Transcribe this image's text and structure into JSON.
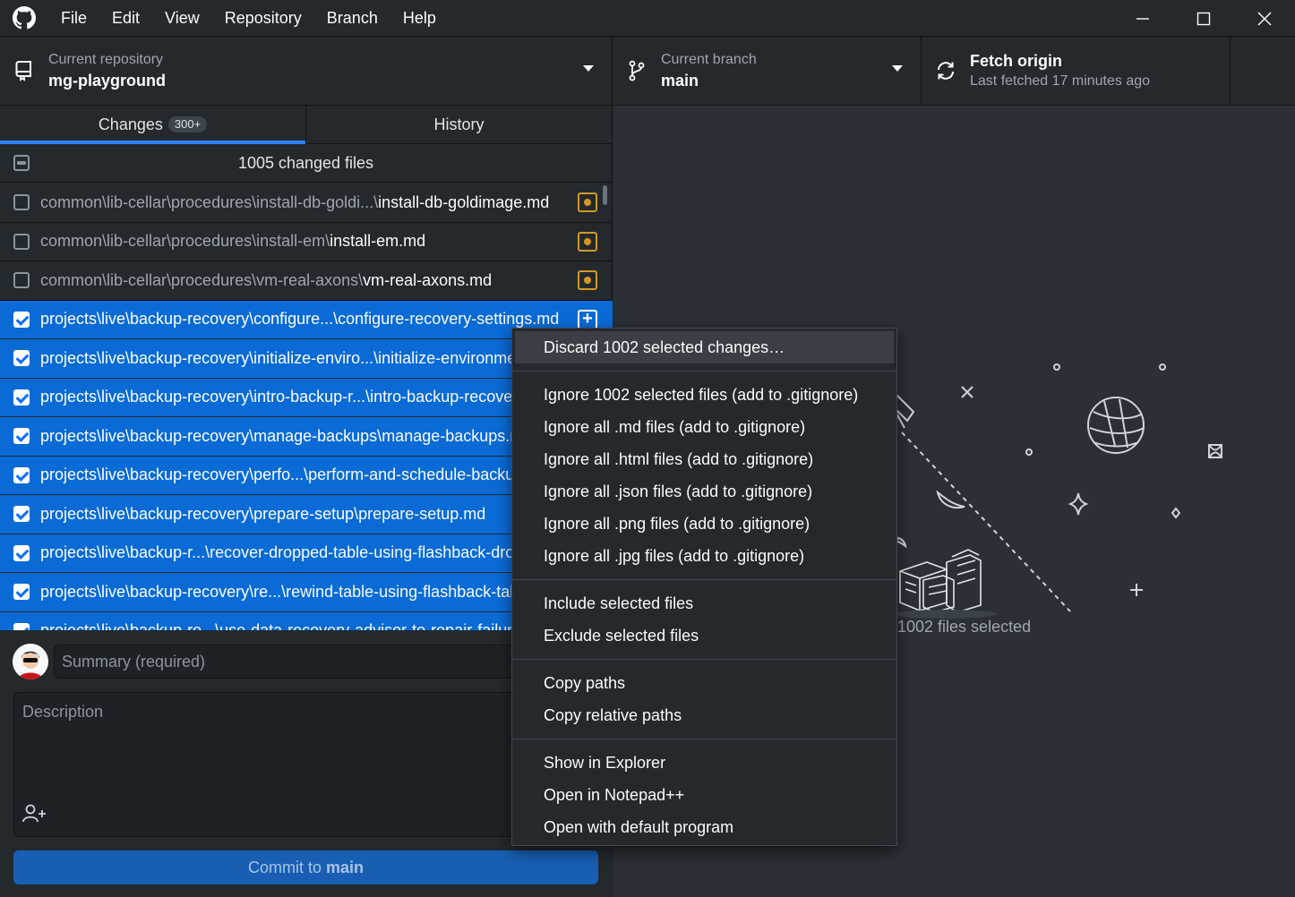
{
  "menu": [
    "File",
    "Edit",
    "View",
    "Repository",
    "Branch",
    "Help"
  ],
  "toolbar": {
    "repo_label": "Current repository",
    "repo_name": "mg-playground",
    "branch_label": "Current branch",
    "branch_name": "main",
    "fetch_title": "Fetch origin",
    "fetch_sub": "Last fetched 17 minutes ago"
  },
  "tabs": {
    "changes": "Changes",
    "changes_badge": "300+",
    "history": "History"
  },
  "changes_header": "1005 changed files",
  "files": [
    {
      "dir": "common\\lib-cellar\\procedures\\install-db-goldi...\\",
      "name": "install-db-goldimage.md",
      "checked": false,
      "status": "modified"
    },
    {
      "dir": "common\\lib-cellar\\procedures\\install-em\\",
      "name": "install-em.md",
      "checked": false,
      "status": "modified"
    },
    {
      "dir": "common\\lib-cellar\\procedures\\vm-real-axons\\",
      "name": "vm-real-axons.md",
      "checked": false,
      "status": "modified"
    },
    {
      "dir": "projects\\live\\backup-recovery\\configure...\\",
      "name": "configure-recovery-settings.md",
      "checked": true,
      "status": "added"
    },
    {
      "dir": "projects\\live\\backup-recovery\\initialize-enviro...\\",
      "name": "initialize-environment.md",
      "checked": true,
      "status": "added"
    },
    {
      "dir": "projects\\live\\backup-recovery\\intro-backup-r...\\",
      "name": "intro-backup-recovery.md",
      "checked": true,
      "status": "added"
    },
    {
      "dir": "projects\\live\\backup-recovery\\manage-backups\\",
      "name": "manage-backups.md",
      "checked": true,
      "status": "added"
    },
    {
      "dir": "projects\\live\\backup-recovery\\perfo...\\",
      "name": "perform-and-schedule-backups.md",
      "checked": true,
      "status": "added"
    },
    {
      "dir": "projects\\live\\backup-recovery\\prepare-setup\\",
      "name": "prepare-setup.md",
      "checked": true,
      "status": "added"
    },
    {
      "dir": "projects\\live\\backup-r...\\",
      "name": "recover-dropped-table-using-flashback-drop.md",
      "checked": true,
      "status": "added"
    },
    {
      "dir": "projects\\live\\backup-recovery\\re...\\",
      "name": "rewind-table-using-flashback-table.md",
      "checked": true,
      "status": "added"
    },
    {
      "dir": "projects\\live\\backup-re...\\",
      "name": "use-data-recovery-advisor-to-repair-failures.md",
      "checked": true,
      "status": "added"
    }
  ],
  "commit": {
    "summary_placeholder": "Summary (required)",
    "description_placeholder": "Description",
    "button_prefix": "Commit to ",
    "button_branch": "main"
  },
  "blank": {
    "label": "1002 files selected"
  },
  "context_menu": {
    "groups": [
      [
        "Discard 1002 selected changes…"
      ],
      [
        "Ignore 1002 selected files (add to .gitignore)",
        "Ignore all .md files (add to .gitignore)",
        "Ignore all .html files (add to .gitignore)",
        "Ignore all .json files (add to .gitignore)",
        "Ignore all .png files (add to .gitignore)",
        "Ignore all .jpg files (add to .gitignore)"
      ],
      [
        "Include selected files",
        "Exclude selected files"
      ],
      [
        "Copy paths",
        "Copy relative paths"
      ],
      [
        "Show in Explorer",
        "Open in Notepad++",
        "Open with default program"
      ]
    ]
  },
  "colors": {
    "accent": "#0a6bd6",
    "modified": "#d29922",
    "background": "#24292e"
  }
}
